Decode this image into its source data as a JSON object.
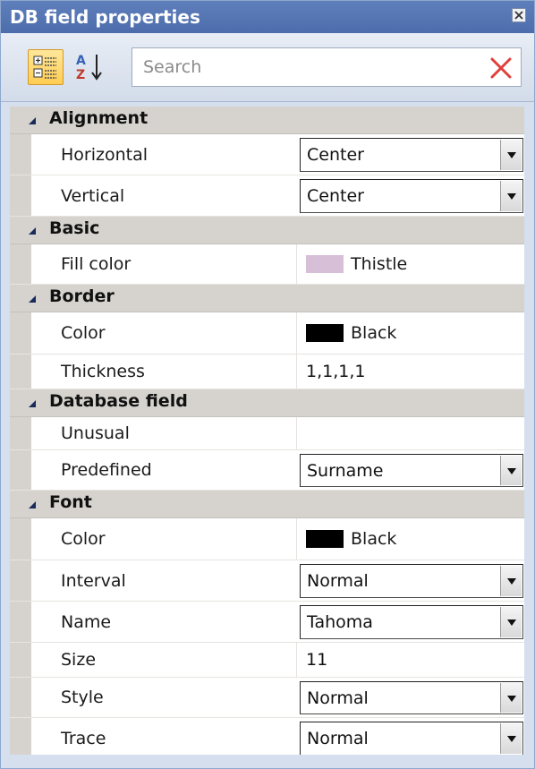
{
  "window": {
    "title": "DB field properties"
  },
  "toolbar": {
    "search_placeholder": "Search",
    "categorized_icon": "categorized-view-icon",
    "alphabetical_icon": "sort-az-icon",
    "clear_icon": "red-x-clear-icon"
  },
  "colors": {
    "titlebar": "#4c6cab",
    "category_bg": "#d6d3ce",
    "thistle": "#d8bfd8",
    "black": "#000000"
  },
  "categories": [
    {
      "name": "Alignment",
      "rows": [
        {
          "label": "Horizontal",
          "value": "Center",
          "kind": "combo"
        },
        {
          "label": "Vertical",
          "value": "Center",
          "kind": "combo"
        }
      ]
    },
    {
      "name": "Basic",
      "rows": [
        {
          "label": "Fill color",
          "value": "Thistle",
          "kind": "color",
          "color": "#d8bfd8"
        }
      ]
    },
    {
      "name": "Border",
      "rows": [
        {
          "label": "Color",
          "value": "Black",
          "kind": "color",
          "color": "#000000"
        },
        {
          "label": "Thickness",
          "value": "1,1,1,1",
          "kind": "text"
        }
      ]
    },
    {
      "name": "Database field",
      "rows": [
        {
          "label": "Unusual",
          "value": "",
          "kind": "text"
        },
        {
          "label": "Predefined",
          "value": "Surname",
          "kind": "combo"
        }
      ]
    },
    {
      "name": "Font",
      "rows": [
        {
          "label": "Color",
          "value": "Black",
          "kind": "color",
          "color": "#000000"
        },
        {
          "label": "Interval",
          "value": "Normal",
          "kind": "combo"
        },
        {
          "label": "Name",
          "value": "Tahoma",
          "kind": "combo"
        },
        {
          "label": "Size",
          "value": "11",
          "kind": "text"
        },
        {
          "label": "Style",
          "value": "Normal",
          "kind": "combo"
        },
        {
          "label": "Trace",
          "value": "Normal",
          "kind": "combo"
        }
      ]
    }
  ]
}
